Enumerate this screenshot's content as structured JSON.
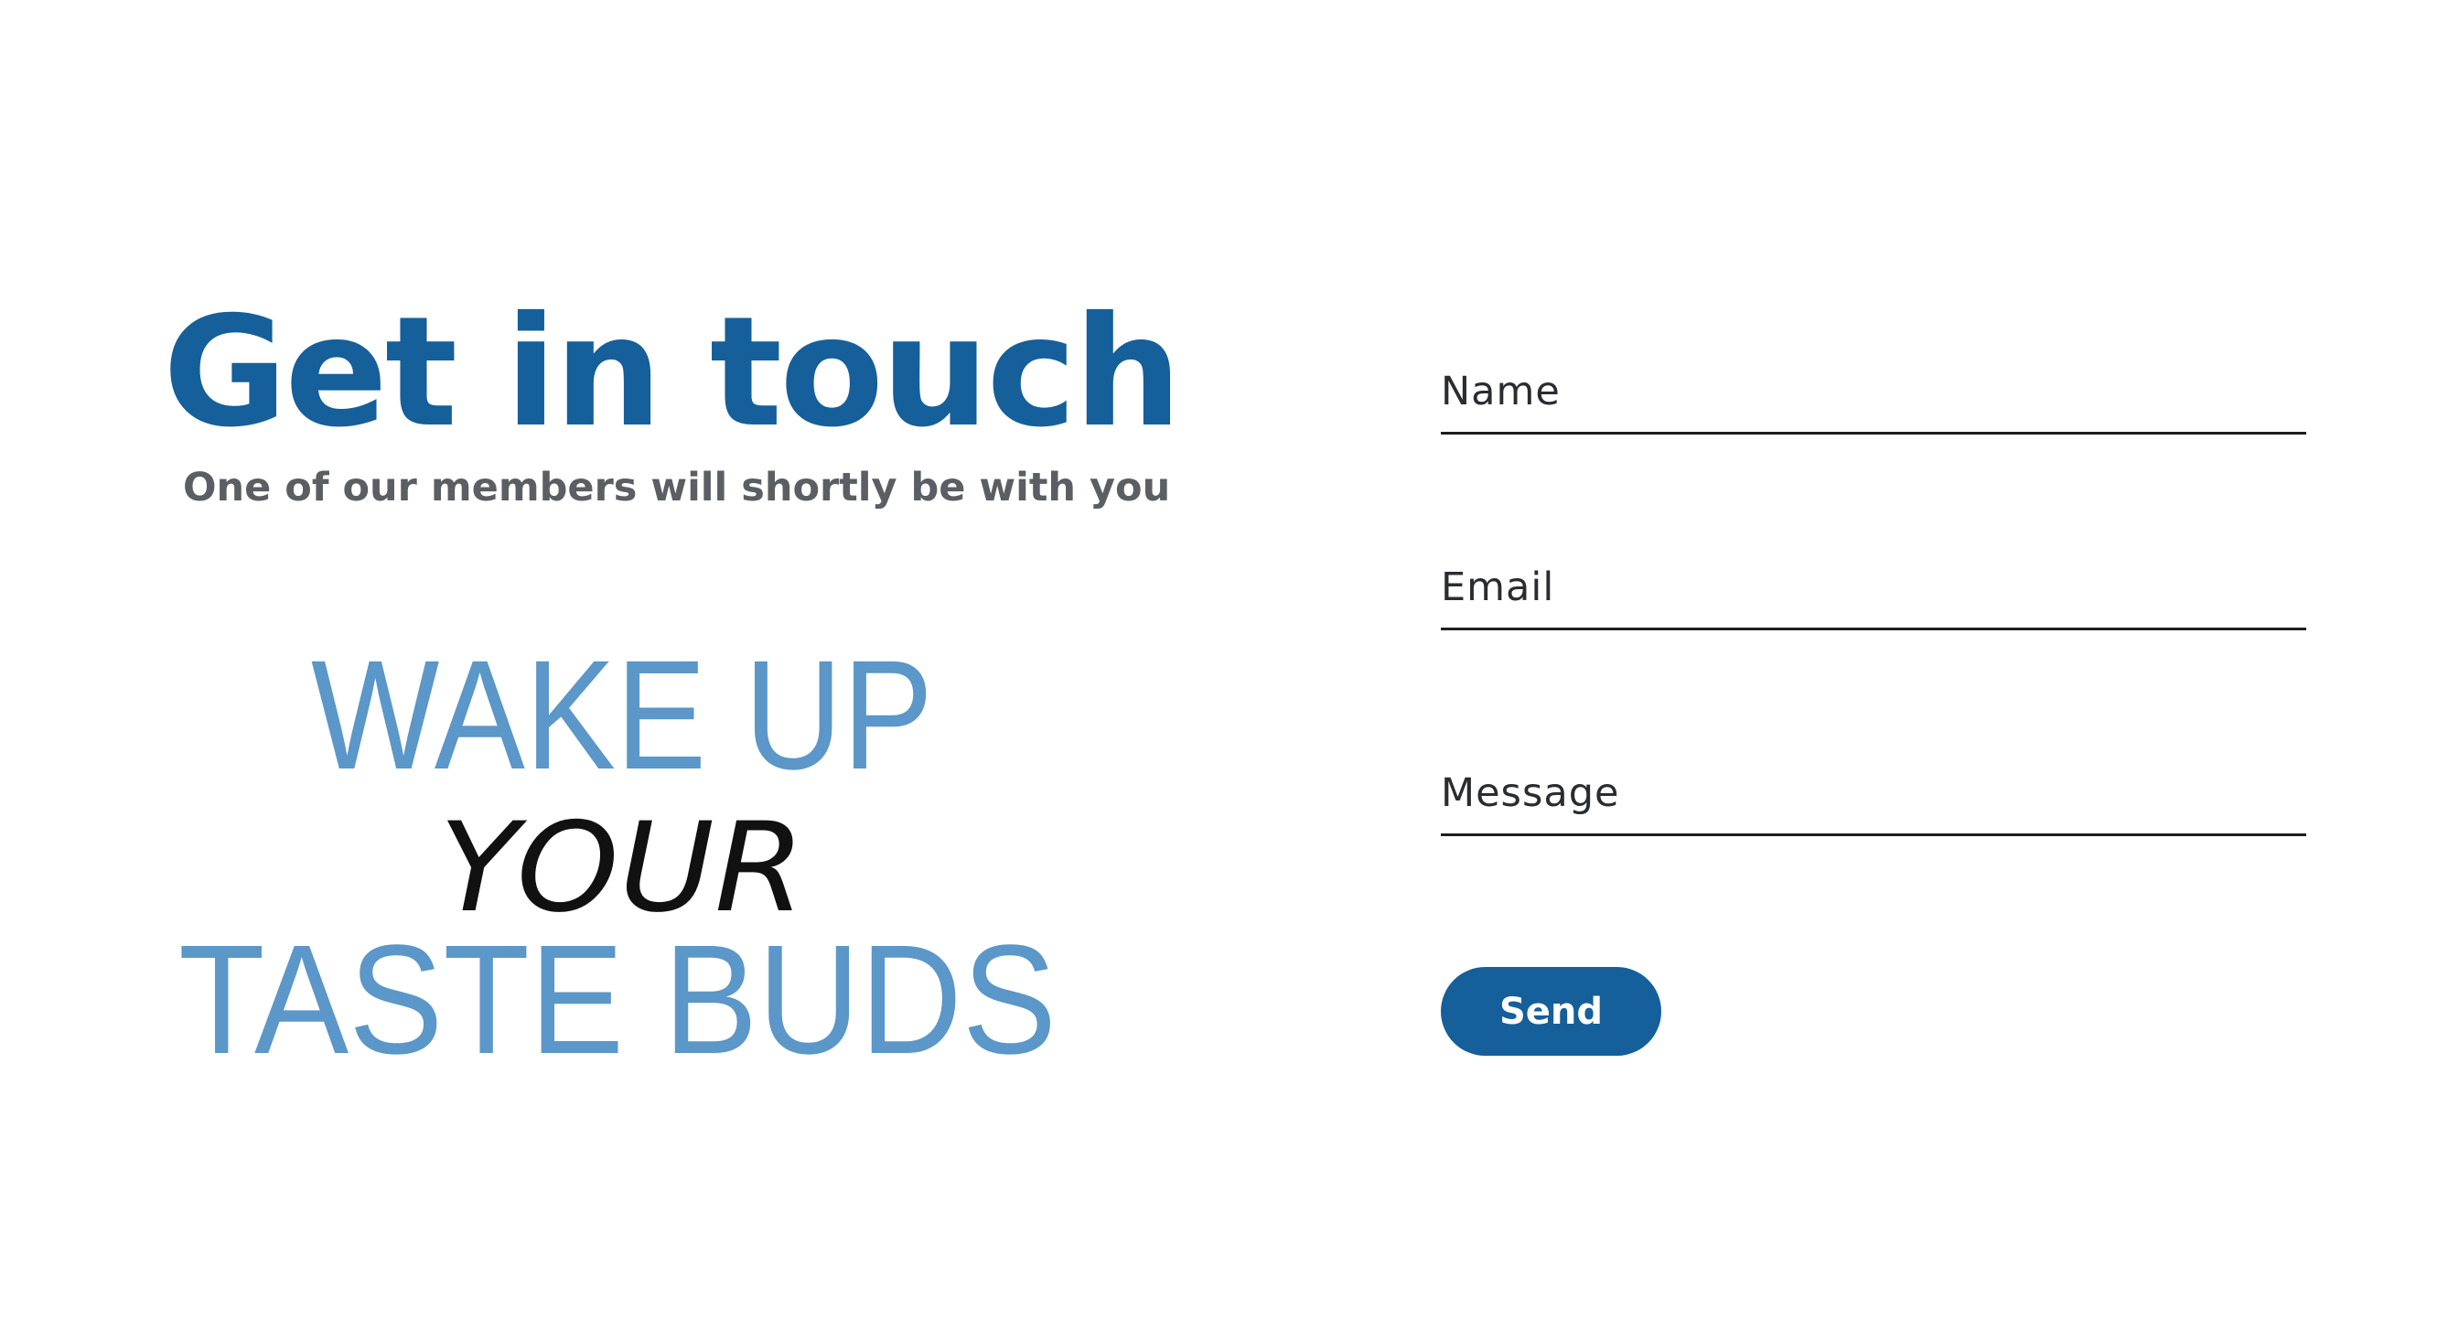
{
  "contact": {
    "heading": "Get in touch",
    "subheading": "One of our members will shortly be with you"
  },
  "logo": {
    "line1": "WAKE UP",
    "line2": "YOUR",
    "line3": "TASTE BUDS"
  },
  "form": {
    "name_label": "Name",
    "email_label": "Email",
    "message_label": "Message",
    "send_label": "Send"
  },
  "colors": {
    "brand_blue": "#155f9a",
    "logo_blue": "#5b97c8",
    "text_gray": "#5b5e63",
    "background": "#ffffff"
  }
}
